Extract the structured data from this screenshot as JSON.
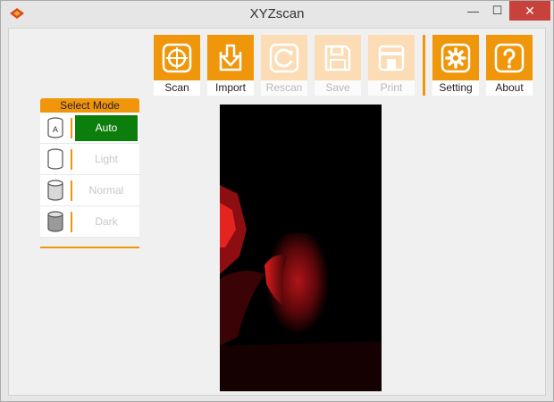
{
  "window": {
    "title": "XYZscan",
    "minimize_symbol": "—",
    "maximize_symbol": "☐",
    "close_symbol": "✕"
  },
  "toolbar": {
    "buttons": [
      {
        "label": "Scan",
        "icon": "scan-target-icon",
        "enabled": true
      },
      {
        "label": "Import",
        "icon": "import-arrow-icon",
        "enabled": true
      },
      {
        "label": "Rescan",
        "icon": "rescan-icon",
        "enabled": false
      },
      {
        "label": "Save",
        "icon": "save-disk-icon",
        "enabled": false
      },
      {
        "label": "Print",
        "icon": "print-icon",
        "enabled": false
      },
      {
        "label": "Setting",
        "icon": "gear-icon",
        "enabled": true
      },
      {
        "label": "About",
        "icon": "question-mark-icon",
        "enabled": true
      }
    ]
  },
  "mode_panel": {
    "header": "Select Mode",
    "modes": [
      {
        "label": "Auto",
        "icon_letter": "A",
        "active": true
      },
      {
        "label": "Light",
        "icon_letter": "",
        "active": false
      },
      {
        "label": "Normal",
        "icon_letter": "",
        "active": false
      },
      {
        "label": "Dark",
        "icon_letter": "",
        "active": false
      }
    ]
  },
  "colors": {
    "accent_orange": "#f0960a",
    "disabled_orange": "#fbdcb4",
    "active_green": "#0c7e0c",
    "close_red": "#c7423a",
    "preview_red": "#c0141a"
  }
}
